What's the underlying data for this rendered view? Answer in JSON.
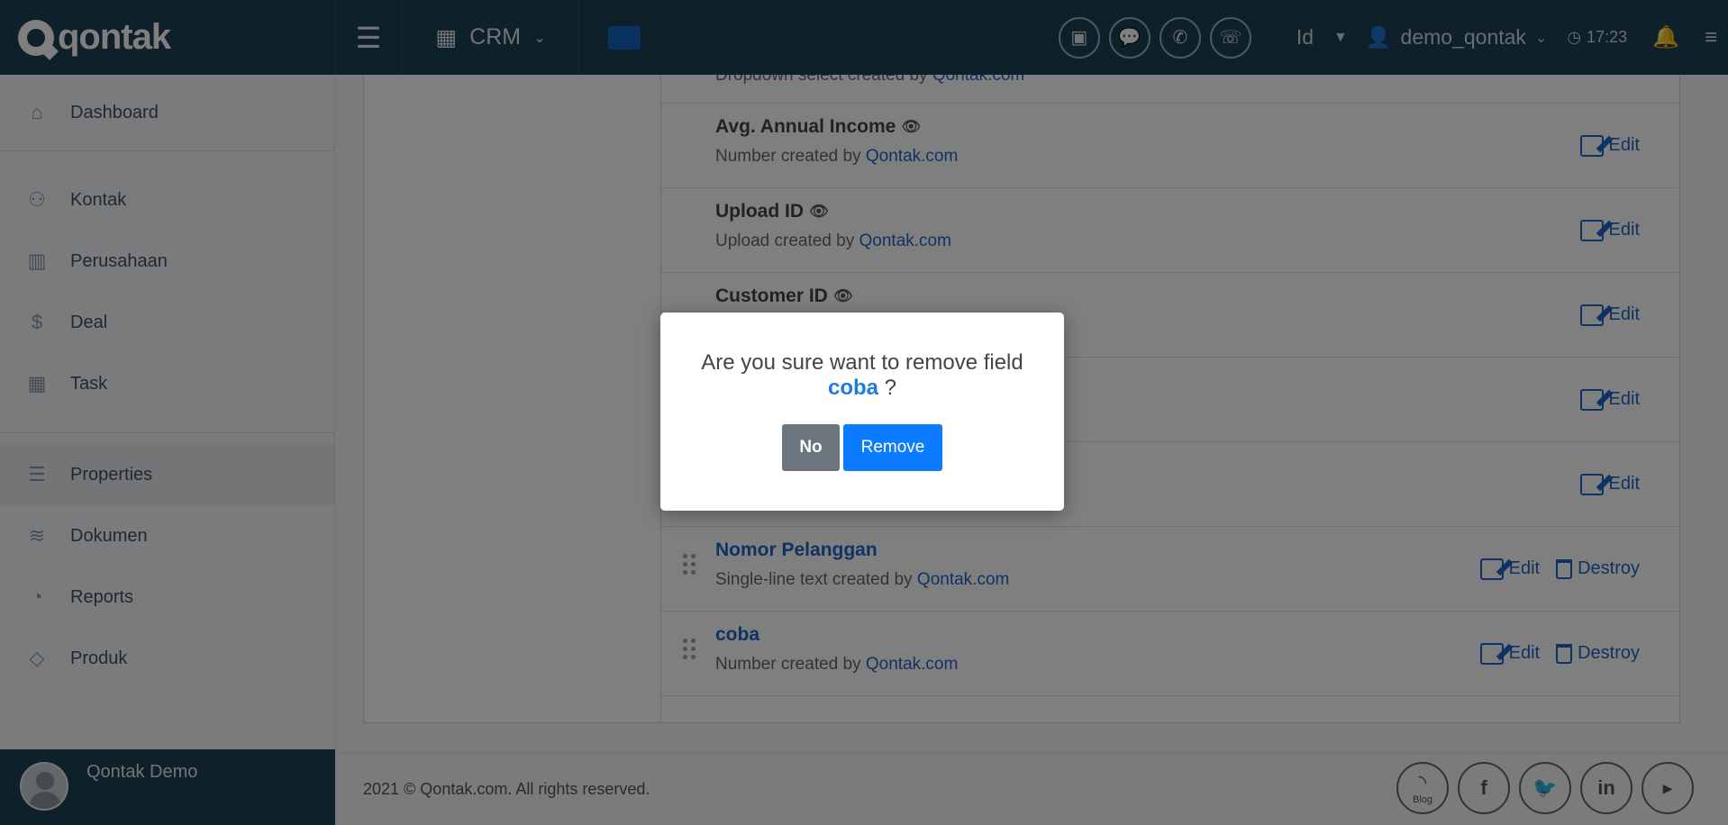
{
  "topbar": {
    "brand": "qontak",
    "app_switcher": "CRM",
    "language": "Id",
    "username": "demo_qontak",
    "time": "17:23"
  },
  "sidebar": {
    "items": [
      {
        "label": "Dashboard",
        "icon": "home-icon"
      },
      {
        "label": "Kontak",
        "icon": "users-icon"
      },
      {
        "label": "Perusahaan",
        "icon": "building-icon"
      },
      {
        "label": "Deal",
        "icon": "dollar-icon"
      },
      {
        "label": "Task",
        "icon": "calendar-icon"
      },
      {
        "label": "Properties",
        "icon": "list-icon"
      },
      {
        "label": "Dokumen",
        "icon": "layers-icon"
      },
      {
        "label": "Reports",
        "icon": "pie-chart-icon"
      },
      {
        "label": "Produk",
        "icon": "tag-icon"
      }
    ],
    "profile_name": "Qontak Demo"
  },
  "fields": {
    "top_partial": {
      "type": "Dropdown select",
      "by_text": "created by",
      "by": "Qontak.com"
    },
    "rows": [
      {
        "name": "Avg. Annual Income",
        "type": "Number",
        "by_text": "created by",
        "by": "Qontak.com",
        "edit": "Edit"
      },
      {
        "name": "Upload ID",
        "type": "Upload",
        "by_text": "created by",
        "by": "Qontak.com",
        "edit": "Edit"
      },
      {
        "name": "Customer ID",
        "edit": "Edit"
      },
      {
        "edit": "Edit"
      },
      {
        "edit": "Edit"
      },
      {
        "name": "Nomor Pelanggan",
        "type": "Single-line text",
        "by_text": "created by",
        "by": "Qontak.com",
        "edit": "Edit",
        "destroy": "Destroy"
      },
      {
        "name": "coba",
        "type": "Number",
        "by_text": "created by",
        "by": "Qontak.com",
        "edit": "Edit",
        "destroy": "Destroy"
      }
    ]
  },
  "footer": {
    "copyright": "2021 © Qontak.com. All rights reserved.",
    "blog_label": "Blog"
  },
  "modal": {
    "message": "Are you sure want to remove field",
    "field_name": "coba",
    "suffix": "?",
    "no_label": "No",
    "remove_label": "Remove"
  }
}
